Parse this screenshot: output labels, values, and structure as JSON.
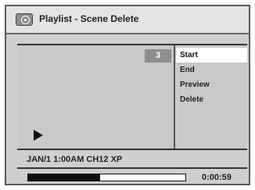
{
  "title": "Playlist - Scene Delete",
  "title_icon": "disc-icon",
  "scene_number": "3",
  "menu": [
    {
      "label": "Start",
      "selected": true
    },
    {
      "label": "End",
      "selected": false
    },
    {
      "label": "Preview",
      "selected": false
    },
    {
      "label": "Delete",
      "selected": false
    }
  ],
  "info": "JAN/1 1:00AM CH12 XP",
  "time": "0:00:59",
  "progress": 0.46,
  "colors": {
    "panel": "#cfcfcf",
    "selected": "#ffffff",
    "badge": "#8e8e8e"
  }
}
